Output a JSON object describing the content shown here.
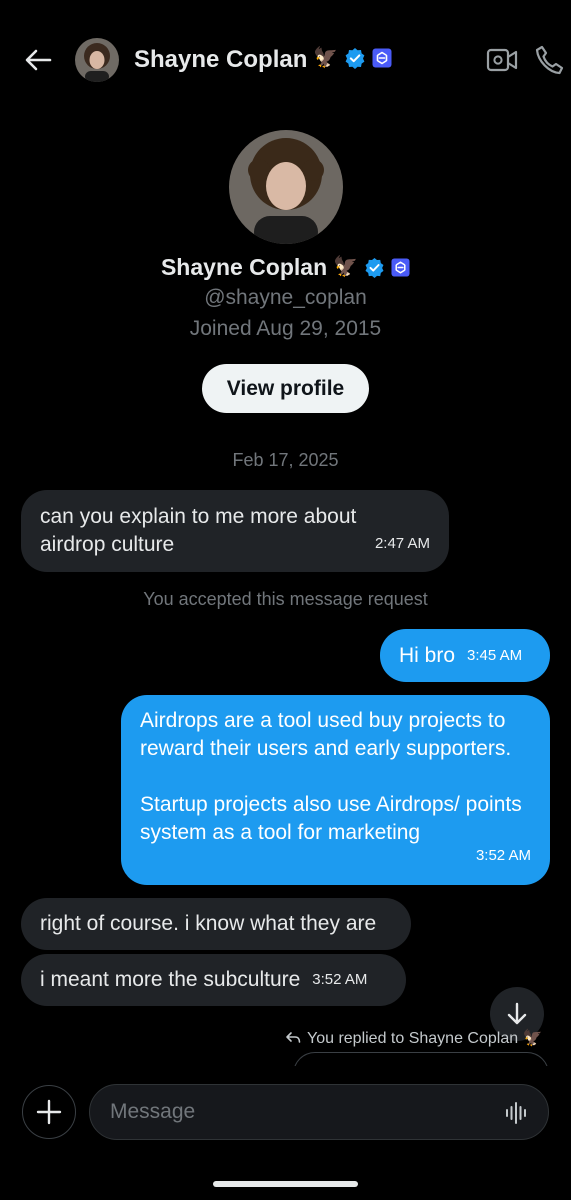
{
  "header": {
    "name": "Shayne Coplan",
    "emoji": "🦅"
  },
  "profile": {
    "name": "Shayne Coplan",
    "emoji": "🦅",
    "handle": "@shayne_coplan",
    "joined": "Joined Aug 29, 2015",
    "view_profile_label": "View profile"
  },
  "conversation": {
    "date_separator": "Feb 17, 2025",
    "system_note": "You accepted this message request",
    "messages": [
      {
        "direction": "in",
        "text": "can you explain to me more about airdrop culture",
        "time": "2:47 AM"
      },
      {
        "direction": "out",
        "text": "Hi bro",
        "time": "3:45 AM"
      },
      {
        "direction": "out",
        "paragraphs": [
          "Airdrops are a tool used buy projects to reward their users and early supporters.",
          "Startup projects also use Airdrops/ points system as a tool for marketing"
        ],
        "time": "3:52 AM"
      },
      {
        "direction": "in",
        "text": "right of course. i know what they are"
      },
      {
        "direction": "in",
        "text": "i meant more the subculture",
        "time": "3:52 AM"
      }
    ],
    "reply_note": "You replied to Shayne Coplan 🦅"
  },
  "composer": {
    "placeholder": "Message"
  },
  "colors": {
    "accent": "#1d9bf0",
    "incoming_bubble": "#202327",
    "verified_badge": "#1d9bf0",
    "affiliate_badge": "#4a5bf7"
  },
  "icons": [
    "back-arrow-icon",
    "verified-badge-icon",
    "affiliate-badge-icon",
    "video-camera-icon",
    "phone-icon",
    "arrow-down-icon",
    "reply-arrow-icon",
    "plus-icon",
    "voice-wave-icon"
  ]
}
